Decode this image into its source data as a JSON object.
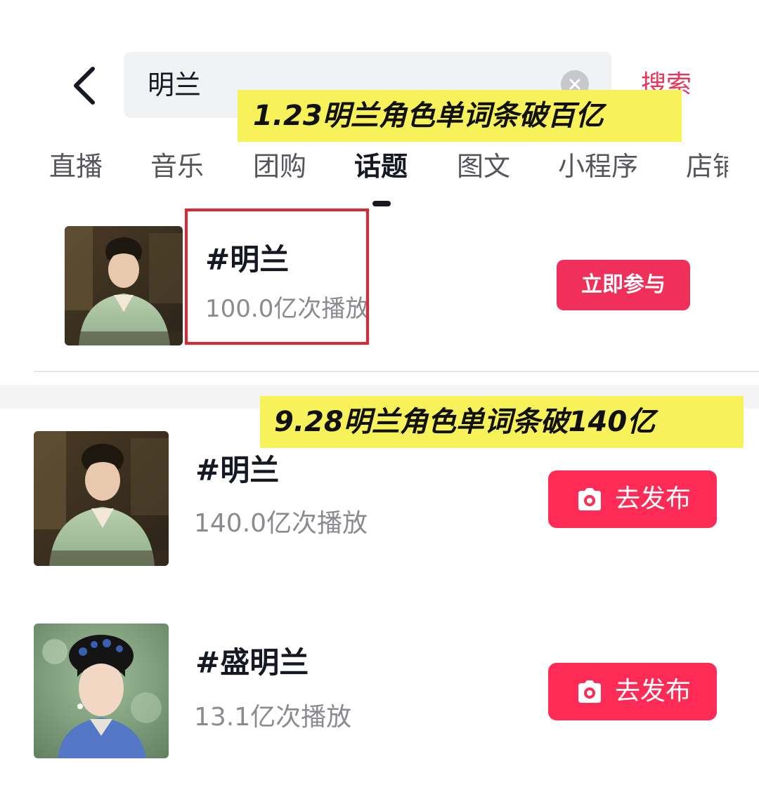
{
  "header": {
    "search_query": "明兰",
    "search_button_label": "搜索"
  },
  "banners": {
    "first": "1.23明兰角色单词条破百亿",
    "second": "9.28明兰角色单词条破140亿"
  },
  "tabs": [
    {
      "label": "直播"
    },
    {
      "label": "音乐"
    },
    {
      "label": "团购"
    },
    {
      "label": "话题",
      "active": true
    },
    {
      "label": "图文"
    },
    {
      "label": "小程序"
    },
    {
      "label": "店铺"
    }
  ],
  "old_result": {
    "title": "#明兰",
    "plays": "100.0亿次播放",
    "button_label": "立即参与"
  },
  "results": [
    {
      "title": "#明兰",
      "plays": "140.0亿次播放",
      "button_label": "去发布"
    },
    {
      "title": "#盛明兰",
      "plays": "13.1亿次播放",
      "button_label": "去发布"
    }
  ],
  "colors": {
    "accent": "#fd2b55",
    "banner": "#f7f25a",
    "highlight_border": "#e0262f"
  }
}
